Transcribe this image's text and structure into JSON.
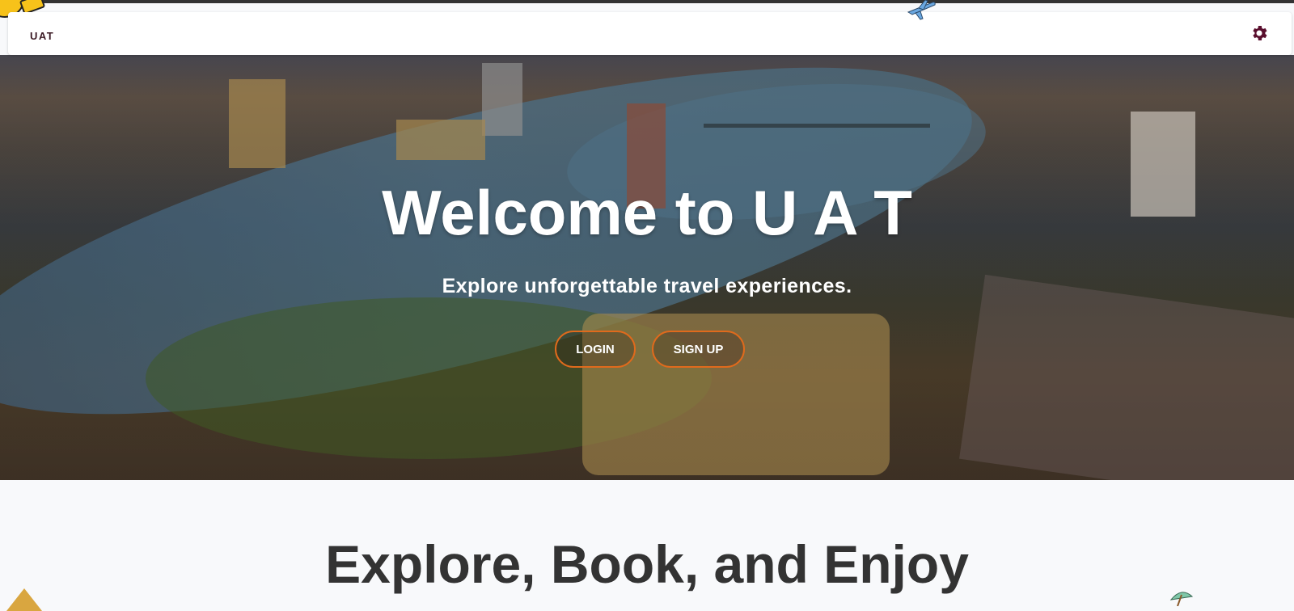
{
  "navbar": {
    "brand": "UAT",
    "settings_icon": "gear-icon"
  },
  "hero": {
    "title": "Welcome to U A T",
    "subtitle": "Explore unforgettable travel experiences.",
    "login_label": "LOGIN",
    "signup_label": "SIGN UP"
  },
  "section": {
    "title": "Explore, Book, and Enjoy"
  },
  "colors": {
    "accent": "#e06a1c",
    "brand_text": "#3b1a24",
    "gear": "#5a0f2e"
  },
  "decorations": [
    "sun-icon",
    "plane-icon",
    "pyramid-icon",
    "umbrella-icon"
  ]
}
